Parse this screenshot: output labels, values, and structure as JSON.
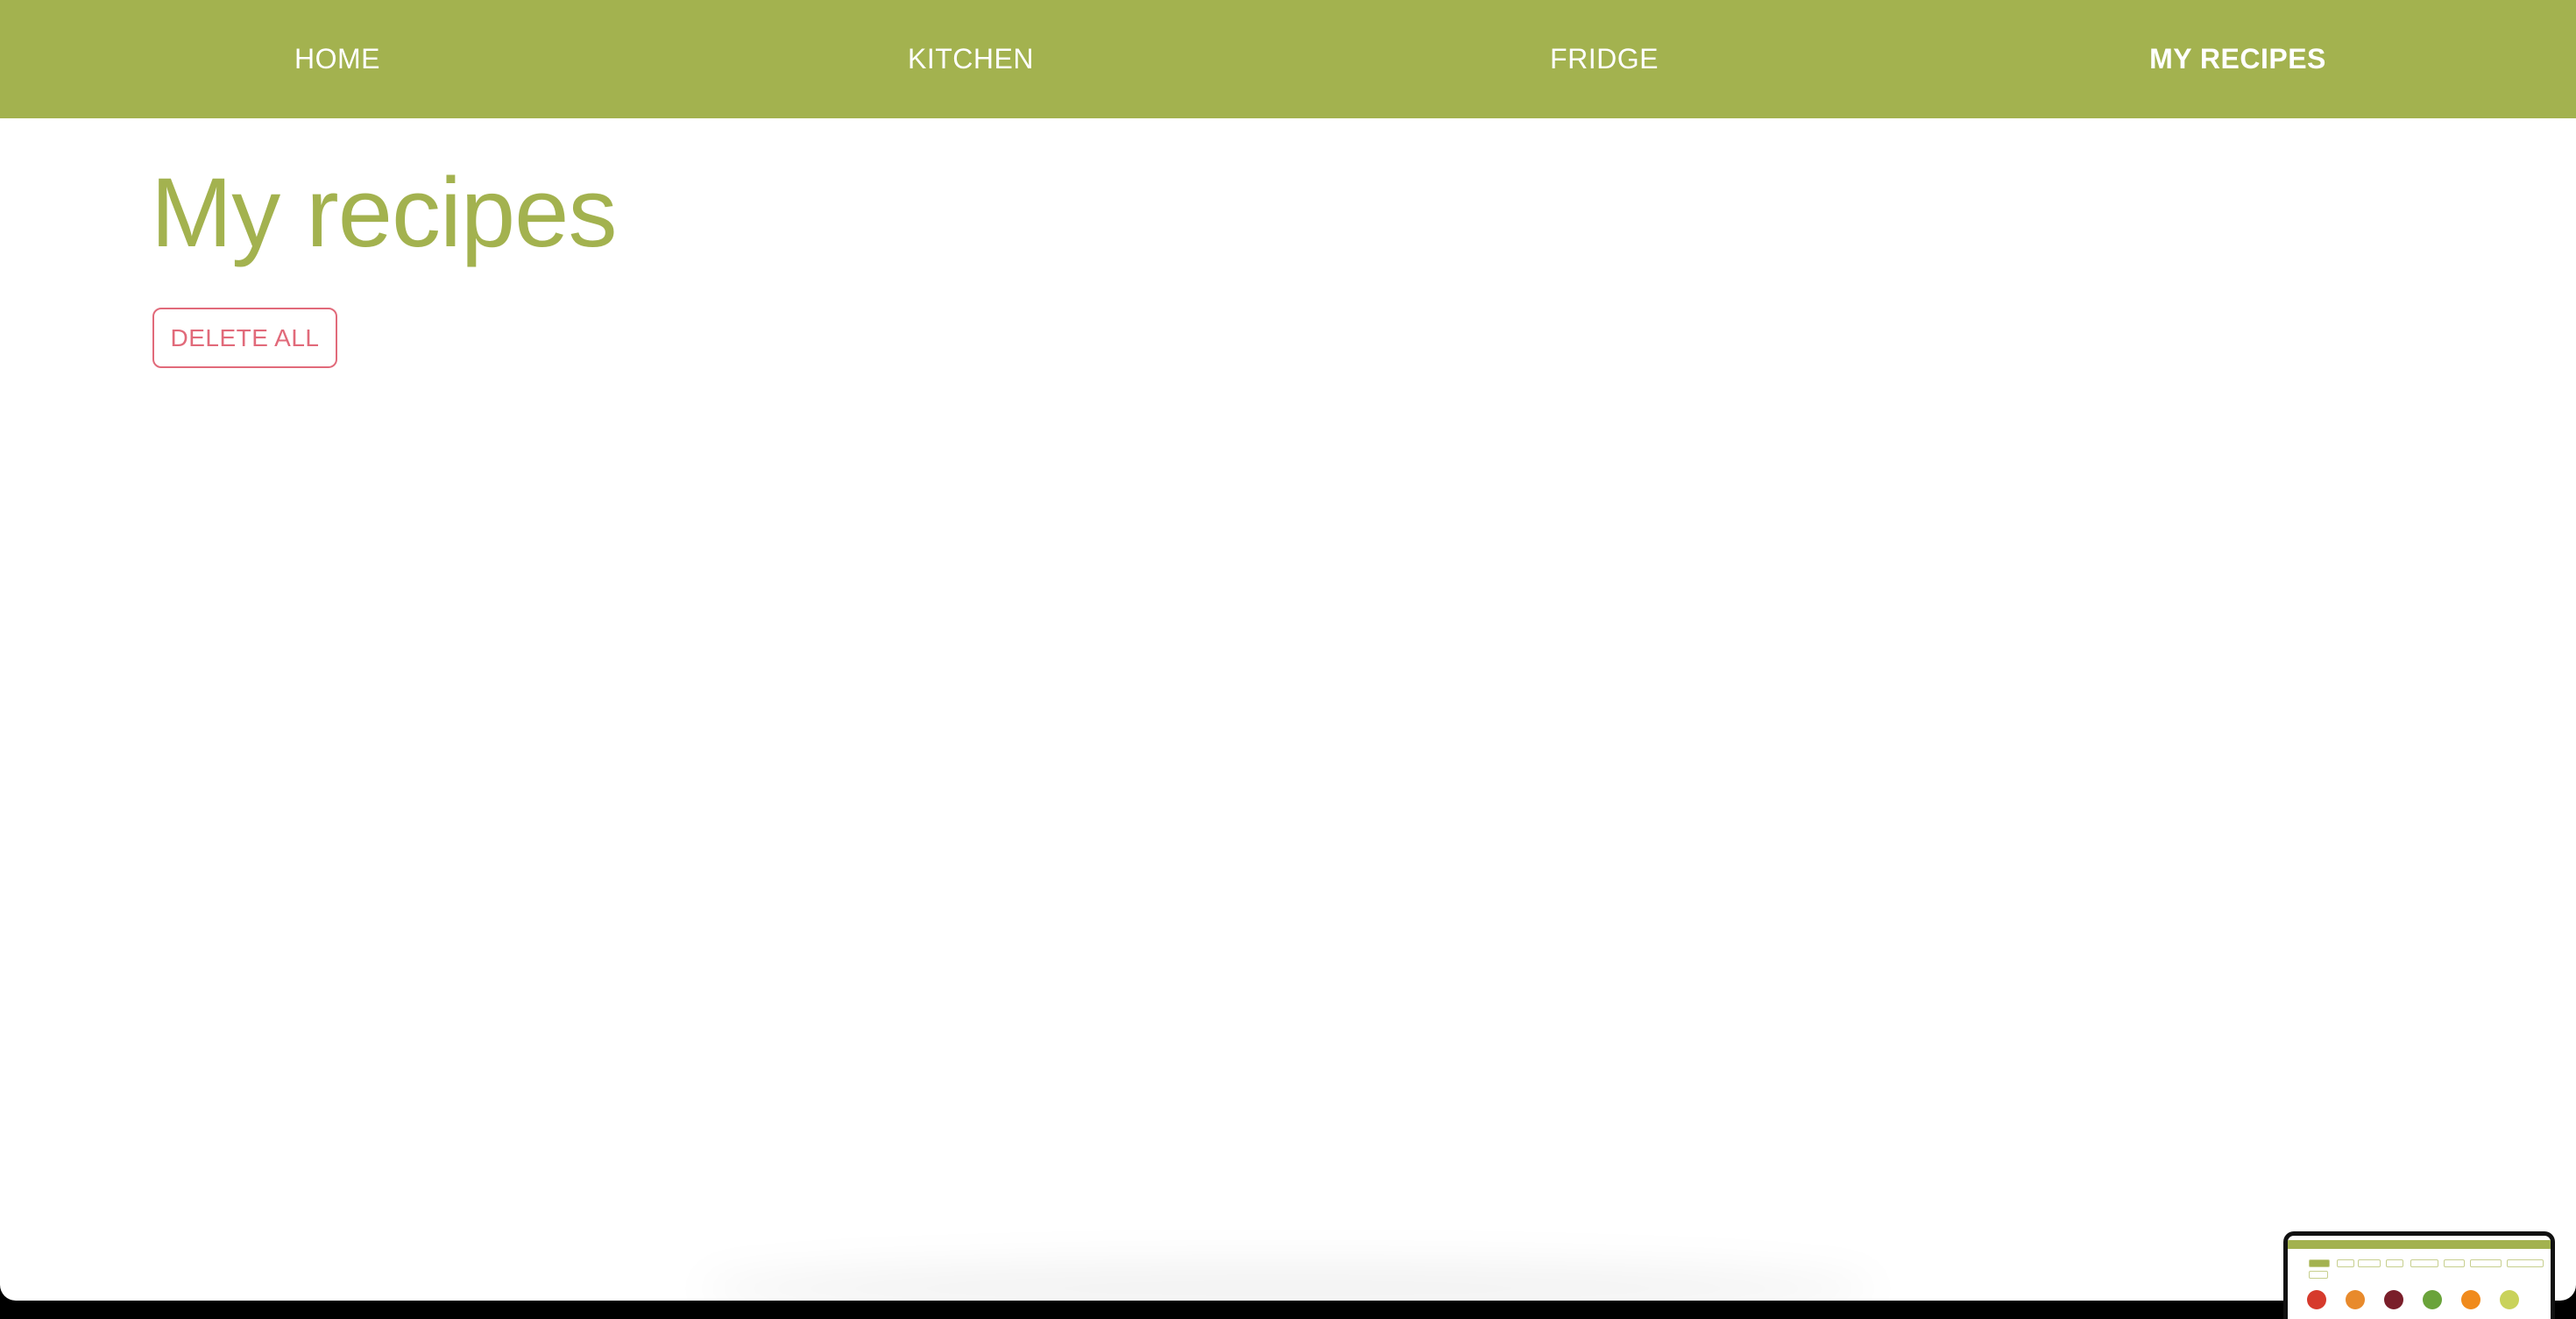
{
  "nav": {
    "items": [
      {
        "label": "HOME",
        "active": false
      },
      {
        "label": "KITCHEN",
        "active": false
      },
      {
        "label": "FRIDGE",
        "active": false
      },
      {
        "label": "MY RECIPES",
        "active": true
      }
    ]
  },
  "main": {
    "title": "My recipes",
    "delete_all_label": "DELETE ALL"
  },
  "colors": {
    "accent": "#a3b24f",
    "danger": "#e16a7a",
    "background": "#ffffff"
  }
}
